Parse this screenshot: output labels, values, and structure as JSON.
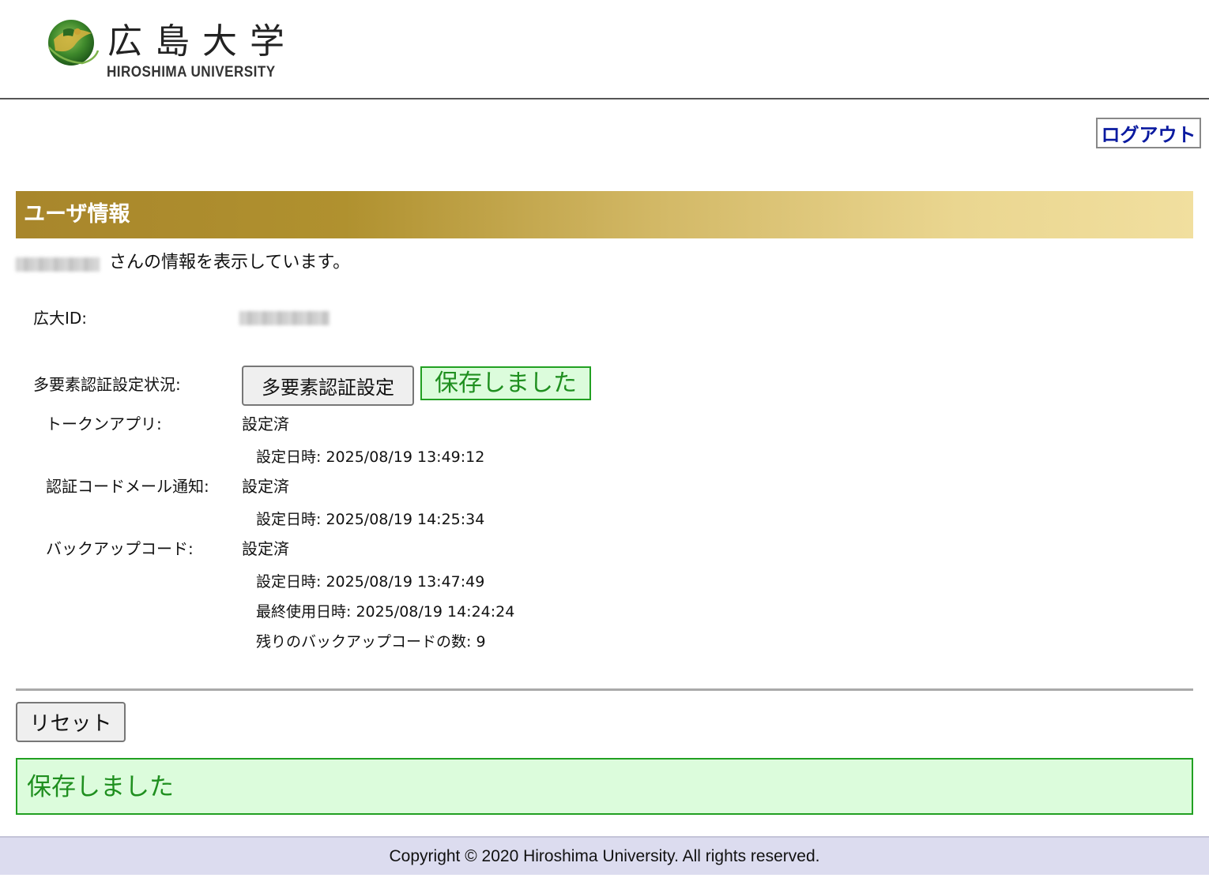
{
  "header": {
    "logo_jp": "広島大学",
    "logo_en": "HIROSHIMA UNIVERSITY",
    "emblem_icon": "university-emblem-icon"
  },
  "nav": {
    "logout_label": "ログアウト"
  },
  "section": {
    "title": "ユーザ情報"
  },
  "user": {
    "intro_suffix": "さんの情報を表示しています。",
    "id_label": "広大ID:"
  },
  "mfa": {
    "status_label": "多要素認証設定状況:",
    "settings_button_label": "多要素認証設定",
    "saved_notice": "保存しました",
    "token_app": {
      "label": "トークンアプリ:",
      "status": "設定済",
      "set_datetime": "設定日時: 2025/08/19 13:49:12"
    },
    "email_notify": {
      "label": "認証コードメール通知:",
      "status": "設定済",
      "set_datetime": "設定日時: 2025/08/19 14:25:34"
    },
    "backup_code": {
      "label": "バックアップコード:",
      "status": "設定済",
      "set_datetime": "設定日時: 2025/08/19 13:47:49",
      "last_used": "最終使用日時: 2025/08/19 14:24:24",
      "remaining": "残りのバックアップコードの数: 9"
    }
  },
  "actions": {
    "reset_label": "リセット"
  },
  "banner": {
    "saved_message": "保存しました"
  },
  "footer": {
    "copyright": "Copyright © 2020 Hiroshima University. All rights reserved."
  },
  "colors": {
    "link_blue": "#0a1aa0",
    "gold_dark": "#a8862b",
    "gold_light": "#f1df9f",
    "success_green": "#1f8f1f",
    "success_bg": "#dcfcdc",
    "footer_bg": "#dcdcef"
  }
}
